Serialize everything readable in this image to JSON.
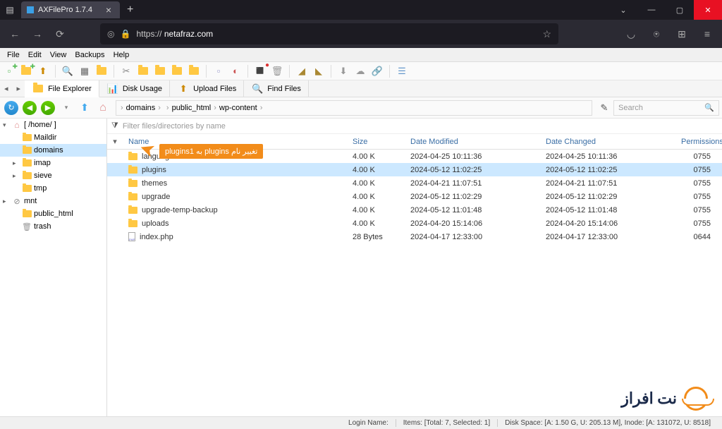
{
  "browser": {
    "tab_title": "AXFilePro 1.7.4",
    "url_prefix": "https://",
    "url_host": "netafraz.com"
  },
  "menubar": [
    "File",
    "Edit",
    "View",
    "Backups",
    "Help"
  ],
  "app_tabs": [
    {
      "label": "File Explorer",
      "active": true
    },
    {
      "label": "Disk Usage",
      "active": false
    },
    {
      "label": "Upload Files",
      "active": false
    },
    {
      "label": "Find Files",
      "active": false
    }
  ],
  "breadcrumb": [
    "domains",
    "",
    "public_html",
    "wp-content"
  ],
  "search_placeholder": "Search",
  "filter_placeholder": "Filter files/directories by name",
  "tree": {
    "root": "[ /home/   ]",
    "items": [
      {
        "label": "Maildir",
        "type": "folder",
        "indent": 1
      },
      {
        "label": "domains",
        "type": "folder",
        "indent": 1,
        "selected": true
      },
      {
        "label": "imap",
        "type": "folder",
        "indent": 1,
        "expandable": true
      },
      {
        "label": "sieve",
        "type": "folder",
        "indent": 1,
        "expandable": true
      },
      {
        "label": "tmp",
        "type": "folder",
        "indent": 1
      },
      {
        "label": "mnt",
        "type": "disk",
        "indent": 0,
        "expandable": true
      },
      {
        "label": "public_html",
        "type": "folder",
        "indent": 1
      },
      {
        "label": "trash",
        "type": "trash",
        "indent": 1
      }
    ]
  },
  "columns": {
    "name": "Name",
    "size": "Size",
    "modified": "Date Modified",
    "changed": "Date Changed",
    "perm": "Permissions"
  },
  "files": [
    {
      "name": "languages",
      "type": "folder",
      "size": "4.00 K",
      "mod": "2024-04-25 10:11:36",
      "chg": "2024-04-25 10:11:36",
      "perm": "0755"
    },
    {
      "name": "plugins",
      "type": "folder",
      "size": "4.00 K",
      "mod": "2024-05-12 11:02:25",
      "chg": "2024-05-12 11:02:25",
      "perm": "0755",
      "selected": true
    },
    {
      "name": "themes",
      "type": "folder",
      "size": "4.00 K",
      "mod": "2024-04-21 11:07:51",
      "chg": "2024-04-21 11:07:51",
      "perm": "0755"
    },
    {
      "name": "upgrade",
      "type": "folder",
      "size": "4.00 K",
      "mod": "2024-05-12 11:02:29",
      "chg": "2024-05-12 11:02:29",
      "perm": "0755"
    },
    {
      "name": "upgrade-temp-backup",
      "type": "folder",
      "size": "4.00 K",
      "mod": "2024-05-12 11:01:48",
      "chg": "2024-05-12 11:01:48",
      "perm": "0755"
    },
    {
      "name": "uploads",
      "type": "folder",
      "size": "4.00 K",
      "mod": "2024-04-20 15:14:06",
      "chg": "2024-04-20 15:14:06",
      "perm": "0755"
    },
    {
      "name": "index.php",
      "type": "file",
      "size": "28 Bytes",
      "mod": "2024-04-17 12:33:00",
      "chg": "2024-04-17 12:33:00",
      "perm": "0644"
    }
  ],
  "callout": "تغییر نام plugins به plugins1",
  "status": {
    "login": "Login Name:",
    "items": "Items: [Total: 7, Selected: 1]",
    "disk": "Disk Space: [A: 1.50 G, U: 205.13 M], Inode: [A: 131072, U: 8518]"
  },
  "logo_text": "نت‌ افراز"
}
